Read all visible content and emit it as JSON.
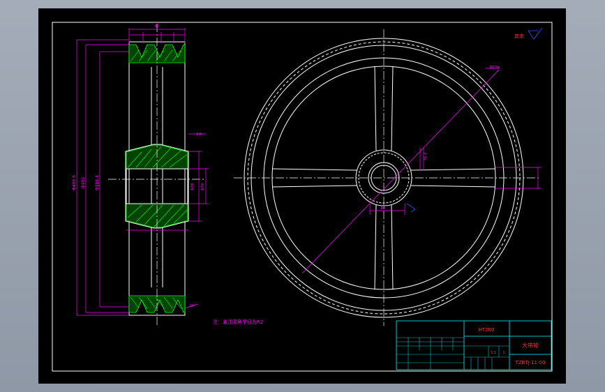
{
  "drawing": {
    "note": "注：未注圆角半径为R2",
    "roughness_label": "其余",
    "section_marks": [
      "A",
      "A"
    ],
    "dimension_labels": {
      "outer_dia": "Φ406.6",
      "pitch_dia": "Φ400",
      "groove_dia": "Φ386.4",
      "hub_width": "82",
      "bore": "Φ38",
      "keyway": "10",
      "rim_chamfer": "1.6",
      "radius_note": "R200",
      "hub_dim": "Φ70",
      "key_height": "41.3",
      "face_width": "20"
    }
  },
  "title_block": {
    "material": "HT200",
    "drawing_name": "大带轮",
    "drawing_number": "TZBTJ-11-00",
    "scale": "1:1",
    "count": "1",
    "weight": ""
  },
  "colors": {
    "background": "#000000",
    "outline": "#ffffff",
    "dimension": "#ff00ff",
    "hatch": "#00ff00",
    "title_border": "#00c8c8",
    "title_text": "#ff3030",
    "leader": "#3050ff"
  }
}
